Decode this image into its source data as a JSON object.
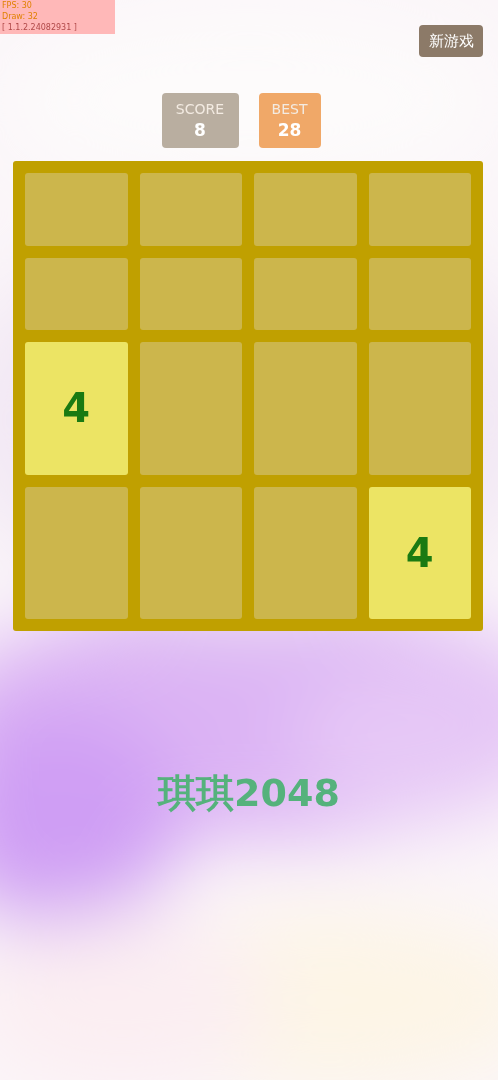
{
  "debug_overlay": {
    "lines": [
      "FPS: 30",
      "Draw: 32",
      "[ 1.1.2.24082931 ]"
    ]
  },
  "new_game_button": {
    "label": "新游戏"
  },
  "scores": [
    {
      "kind": "score",
      "label": "SCORE",
      "value": "8"
    },
    {
      "kind": "best",
      "label": "BEST",
      "value": "28"
    }
  ],
  "board": {
    "rows": [
      [
        {
          "kind": "empty"
        },
        {
          "kind": "empty"
        },
        {
          "kind": "empty"
        },
        {
          "kind": "empty"
        }
      ],
      [
        {
          "kind": "empty"
        },
        {
          "kind": "empty"
        },
        {
          "kind": "empty"
        },
        {
          "kind": "empty"
        }
      ],
      [
        {
          "kind": "tile",
          "value": "4"
        },
        {
          "kind": "empty"
        },
        {
          "kind": "empty"
        },
        {
          "kind": "empty"
        }
      ],
      [
        {
          "kind": "empty"
        },
        {
          "kind": "empty"
        },
        {
          "kind": "empty"
        },
        {
          "kind": "tile",
          "value": "4"
        }
      ]
    ]
  },
  "game_title": "琪琪2048"
}
